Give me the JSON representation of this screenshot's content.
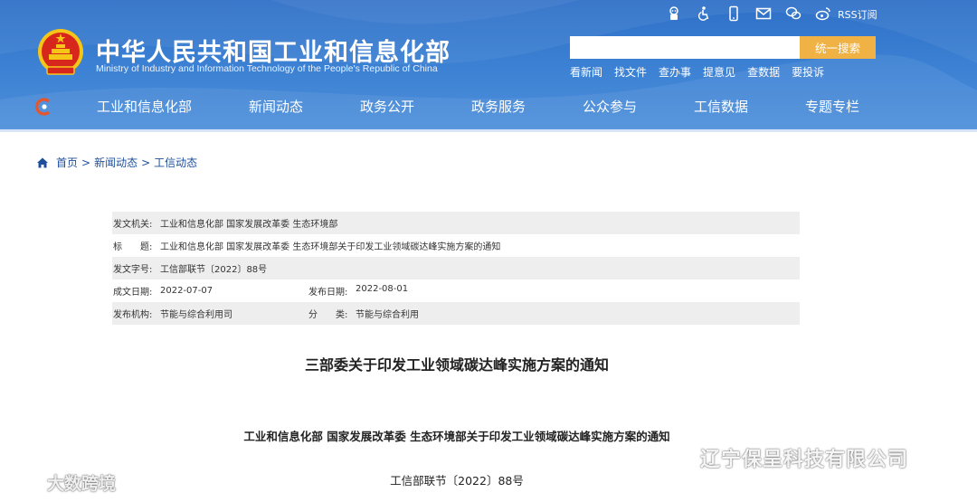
{
  "header": {
    "title": "中华人民共和国工业和信息化部",
    "subtitle": "Ministry of Industry and Information Technology of the People's Republic of China",
    "top_icons": [
      "robot-icon",
      "accessibility-icon",
      "mobile-icon",
      "mail-icon",
      "wechat-icon",
      "weibo-icon"
    ],
    "rss_label": "RSS订阅",
    "search": {
      "placeholder": "",
      "value": "",
      "button_label": "统一搜索"
    },
    "quick_links": [
      "看新闻",
      "找文件",
      "查办事",
      "提意见",
      "查数据",
      "要投诉"
    ],
    "nav": [
      "工业和信息化部",
      "新闻动态",
      "政务公开",
      "政务服务",
      "公众参与",
      "工信数据",
      "专题专栏"
    ],
    "colors": {
      "header_bg": "#3a7fd2",
      "search_button": "#f0b245",
      "emblem_red": "#d7261b",
      "emblem_gold": "#f5c518"
    }
  },
  "breadcrumb": {
    "home": "首页",
    "separator": ">",
    "items": [
      "新闻动态",
      "工信动态"
    ]
  },
  "info_table": {
    "issuer_label": "发文机关:",
    "issuer_value": "工业和信息化部 国家发展改革委 生态环境部",
    "title_label": "标　　题:",
    "title_value": "工业和信息化部 国家发展改革委 生态环境部关于印发工业领域碳达峰实施方案的通知",
    "doc_no_label": "发文字号:",
    "doc_no_value": "工信部联节〔2022〕88号",
    "created_label": "成文日期:",
    "created_value": "2022-07-07",
    "published_label": "发布日期:",
    "published_value": "2022-08-01",
    "org_label": "发布机构:",
    "org_value": "节能与综合利用司",
    "category_label": "分　　类:",
    "category_value": "节能与综合利用"
  },
  "article": {
    "title": "三部委关于印发工业领域碳达峰实施方案的通知",
    "doc_title": "工业和信息化部 国家发展改革委 生态环境部关于印发工业领域碳达峰实施方案的通知",
    "doc_number": "工信部联节〔2022〕88号"
  },
  "watermarks": {
    "left": "大数跨境",
    "right": "辽宁保呈科技有限公司"
  }
}
